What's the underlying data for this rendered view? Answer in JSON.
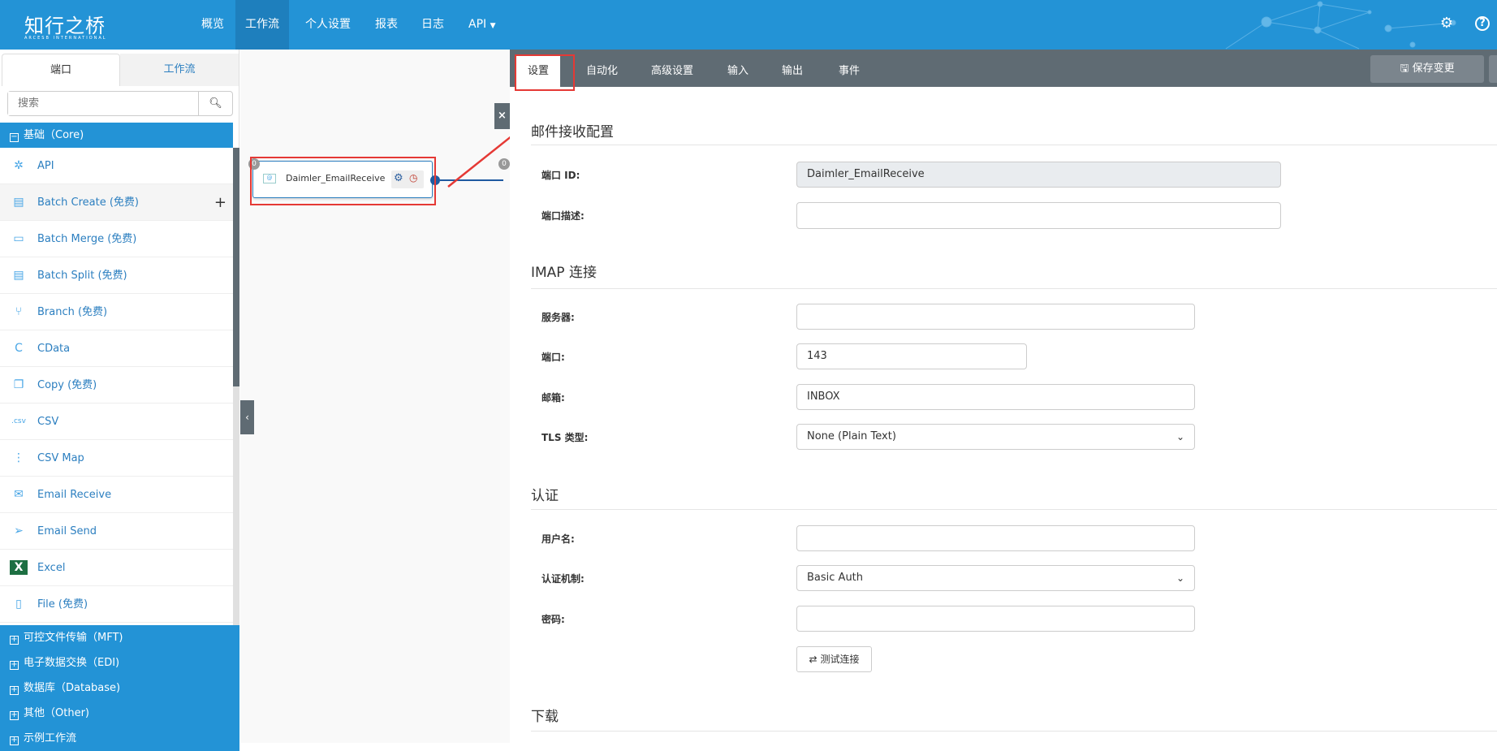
{
  "header": {
    "logo": "知行之桥",
    "logo_sub": "ARCESB INTERNATIONAL",
    "nav": [
      "概览",
      "工作流",
      "个人设置",
      "报表",
      "日志",
      "API"
    ],
    "active_nav": "工作流"
  },
  "left": {
    "tabs": [
      "端口",
      "工作流"
    ],
    "search_placeholder": "搜索",
    "core_category": "基础（Core)",
    "items": [
      {
        "label": "API",
        "icon": "api-icon"
      },
      {
        "label": "Batch Create (免费)",
        "icon": "batch-create-icon"
      },
      {
        "label": "Batch Merge (免费)",
        "icon": "batch-merge-icon"
      },
      {
        "label": "Batch Split (免费)",
        "icon": "batch-split-icon"
      },
      {
        "label": "Branch (免费)",
        "icon": "branch-icon"
      },
      {
        "label": "CData",
        "icon": "cdata-icon"
      },
      {
        "label": "Copy (免费)",
        "icon": "copy-icon"
      },
      {
        "label": "CSV",
        "icon": "csv-icon"
      },
      {
        "label": "CSV Map",
        "icon": "csv-map-icon"
      },
      {
        "label": "Email Receive",
        "icon": "email-receive-icon"
      },
      {
        "label": "Email Send",
        "icon": "email-send-icon"
      },
      {
        "label": "Excel",
        "icon": "excel-icon"
      },
      {
        "label": "File (免费)",
        "icon": "file-icon"
      }
    ],
    "categories": [
      "可控文件传输（MFT)",
      "电子数据交换（EDI)",
      "数据库（Database)",
      "其他（Other)",
      "示例工作流"
    ]
  },
  "canvas": {
    "node_name": "Daimler_EmailReceive",
    "node_count": "0",
    "next_count": "0"
  },
  "right": {
    "tabs": [
      "设置",
      "自动化",
      "高级设置",
      "输入",
      "输出",
      "事件"
    ],
    "save_label": "保存变更",
    "sections": {
      "mail": "邮件接收配置",
      "imap": "IMAP 连接",
      "auth": "认证",
      "download": "下载"
    },
    "fields": {
      "port_id_label": "端口 ID:",
      "port_id": "Daimler_EmailReceive",
      "desc_label": "端口描述:",
      "server_label": "服务器:",
      "server": "",
      "port_label": "端口:",
      "port": "143",
      "mailbox_label": "邮箱:",
      "mailbox": "INBOX",
      "tls_label": "TLS 类型:",
      "tls": "None (Plain Text)",
      "user_label": "用户名:",
      "user": "",
      "authmech_label": "认证机制:",
      "authmech": "Basic Auth",
      "password_label": "密码:",
      "password": ""
    },
    "test_label": "测试连接"
  },
  "colors": {
    "brand": "#2393d6",
    "toolbar": "#5f6b73",
    "highlight": "#e53935"
  }
}
